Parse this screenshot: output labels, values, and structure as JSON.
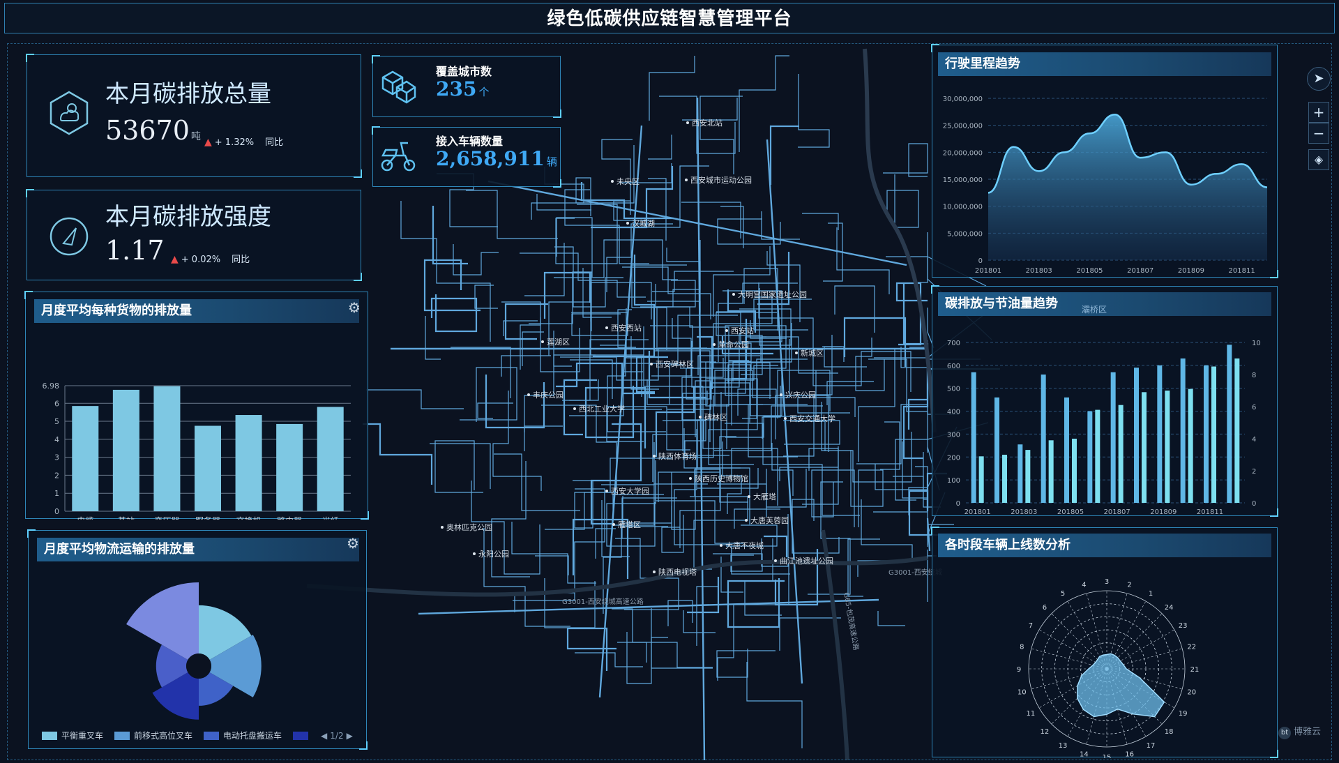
{
  "header": {
    "title": "绿色低碳供应链智慧管理平台"
  },
  "kpi_total": {
    "title": "本月碳排放总量",
    "value": "53670",
    "unit": "吨",
    "delta": "+ 1.32%",
    "compare": "同比",
    "icon": "cloud-sun-hexagon-icon"
  },
  "kpi_intensity": {
    "title": "本月碳排放强度",
    "value": "1.17",
    "delta": "+ 0.02%",
    "compare": "同比",
    "icon": "gauge-icon"
  },
  "cities": {
    "label": "覆盖城市数",
    "value": "235",
    "unit": "个",
    "icon": "boxes-icon"
  },
  "vehicles": {
    "label": "接入车辆数量",
    "value": "2,658,911",
    "unit": "辆",
    "icon": "scooter-icon"
  },
  "map": {
    "labels": [
      "西安北站",
      "西安城市运动公园",
      "未央区",
      "汉城湖",
      "大明宫国家遗址公园",
      "西安西站",
      "西安站",
      "莲湖区",
      "革命公园",
      "新城区",
      "西安碑林区",
      "丰庆公园",
      "兴庆公园",
      "西北工业大学",
      "碑林区",
      "西安交通大学",
      "陕西体育场",
      "陕西历史博物馆",
      "大雁塔",
      "西安大学园",
      "大唐芙蓉园",
      "奥林匹克公园",
      "雁塔区",
      "大唐不夜城",
      "永阳公园",
      "曲江池遗址公园",
      "陕西电视塔",
      "G3001-西安绕城高速公路",
      "G3001-西安绕城",
      "G65-包茂高速公路"
    ],
    "controls": {
      "compass": "compass-icon",
      "zoom_in": "+",
      "zoom_out": "−",
      "layers": "layers-icon"
    }
  },
  "goods_chart": {
    "title": "月度平均每种货物的排放量"
  },
  "logistics_chart": {
    "title": "月度平均物流运输的排放量"
  },
  "mileage_chart": {
    "title": "行驶里程趋势"
  },
  "emission_chart": {
    "title": "碳排放与节油量趋势",
    "tag": "灞桥区"
  },
  "radar_chart": {
    "title": "各时段车辆上线数分析"
  },
  "watermark": {
    "badge": "bt",
    "text": "博雅云"
  },
  "colors": {
    "accent": "#3fa9f5",
    "bar": "#7ec8e3",
    "border": "#2e86b8",
    "delta_up": "#e84a4a"
  },
  "chart_data": [
    {
      "id": "goods",
      "type": "bar",
      "categories": [
        "电缆",
        "基站",
        "变压器",
        "服务器",
        "交换机",
        "路由器",
        "光纤"
      ],
      "values": [
        5.85,
        6.75,
        6.95,
        4.75,
        5.35,
        4.85,
        5.8
      ],
      "ylim": [
        0,
        6.98
      ],
      "yticks": [
        "0",
        "1",
        "2",
        "3",
        "4",
        "5",
        "6",
        "6.98"
      ],
      "grid": true
    },
    {
      "id": "logistics",
      "type": "pie",
      "variant": "rose",
      "series": [
        {
          "name": "平衡重叉车",
          "value": 80,
          "color": "#7ec8e3"
        },
        {
          "name": "前移式高位叉车",
          "value": 83,
          "color": "#5b9bd5"
        },
        {
          "name": "电动托盘搬运车",
          "value": 45,
          "color": "#3f62c8"
        },
        {
          "name": "",
          "value": 68,
          "color": "#2233aa"
        },
        {
          "name": "",
          "value": 50,
          "color": "#4a5fc9"
        },
        {
          "name": "",
          "value": 118,
          "color": "#7b8ae0"
        }
      ],
      "legend_page": "1/2",
      "legend": "bottom"
    },
    {
      "id": "mileage",
      "type": "area",
      "x": [
        "201801",
        "201802",
        "201803",
        "201804",
        "201805",
        "201806",
        "201807",
        "201808",
        "201809",
        "201810",
        "201811",
        "201812"
      ],
      "values": [
        12500000,
        21000000,
        16500000,
        20000000,
        23500000,
        27000000,
        19000000,
        20000000,
        14000000,
        16000000,
        17800000,
        13500000
      ],
      "xticks": [
        "201801",
        "201803",
        "201805",
        "201807",
        "201809",
        "201811"
      ],
      "ylim": [
        0,
        30000000
      ],
      "yticks": [
        "0",
        "5,000,000",
        "10,000,000",
        "15,000,000",
        "20,000,000",
        "25,000,000",
        "30,000,000"
      ],
      "grid": true
    },
    {
      "id": "emission",
      "type": "bar",
      "x": [
        "201801",
        "201802",
        "201803",
        "201804",
        "201805",
        "201806",
        "201807",
        "201808",
        "201809",
        "201810",
        "201811",
        "201812"
      ],
      "series": [
        {
          "axis": "left",
          "values": [
            570,
            460,
            255,
            560,
            460,
            400,
            570,
            590,
            600,
            630,
            600,
            690
          ]
        },
        {
          "axis": "right",
          "values": [
            2.9,
            3.0,
            3.3,
            3.9,
            4.0,
            5.8,
            6.1,
            6.9,
            7.0,
            7.1,
            8.5,
            9.0
          ]
        }
      ],
      "xticks": [
        "201801",
        "201803",
        "201805",
        "201807",
        "201809",
        "201811"
      ],
      "ylim": [
        0,
        700
      ],
      "yticks": [
        "0",
        "100",
        "200",
        "300",
        "400",
        "500",
        "600",
        "700"
      ],
      "y2lim": [
        0,
        10
      ],
      "y2ticks": [
        "0",
        "2",
        "4",
        "6",
        "8",
        "10"
      ],
      "grid": true
    },
    {
      "id": "radar",
      "type": "area",
      "variant": "polar",
      "hours": [
        "1",
        "2",
        "3",
        "4",
        "5",
        "6",
        "7",
        "8",
        "9",
        "10",
        "11",
        "12",
        "13",
        "14",
        "15",
        "16",
        "17",
        "18",
        "19",
        "20",
        "21",
        "22",
        "23",
        "24"
      ],
      "values": [
        1.2,
        1.2,
        1.1,
        1.1,
        1.1,
        1.0,
        1.0,
        1.1,
        1.4,
        2.0,
        2.6,
        3.2,
        3.6,
        3.8,
        3.5,
        3.2,
        4.0,
        5.2,
        5.1,
        2.6,
        1.5,
        1.3,
        1.2,
        1.2
      ],
      "rlim": [
        0,
        6
      ]
    }
  ]
}
